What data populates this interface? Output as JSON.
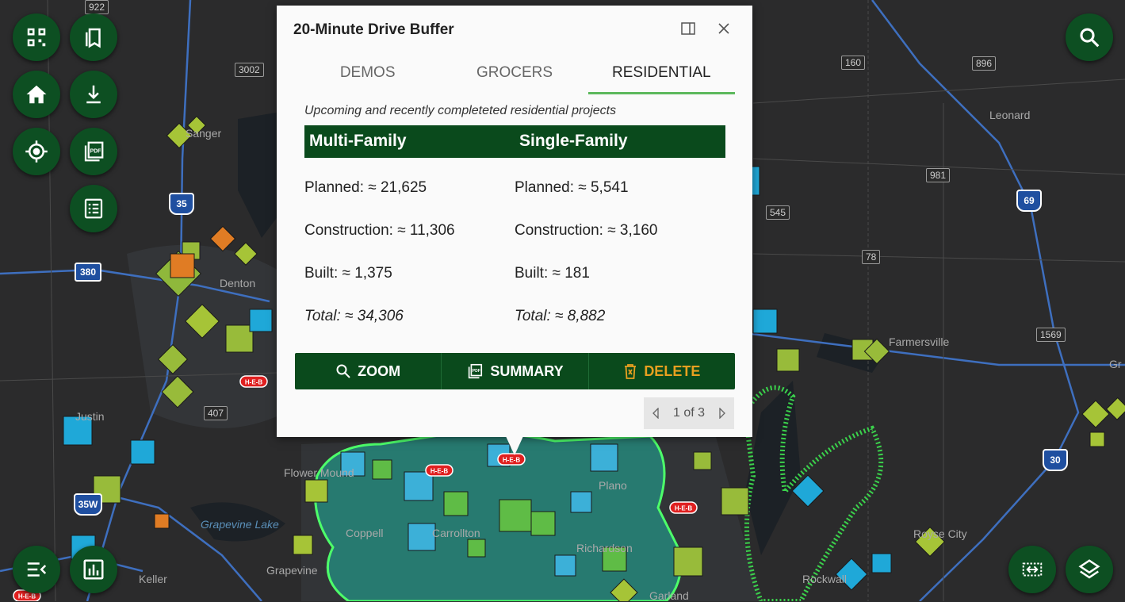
{
  "popup": {
    "title": "20-Minute Drive Buffer",
    "tabs": [
      {
        "label": "DEMOS"
      },
      {
        "label": "GROCERS"
      },
      {
        "label": "RESIDENTIAL"
      }
    ],
    "subtitle": "Upcoming and recently completeted residential projects",
    "columns": [
      "Multi-Family",
      "Single-Family"
    ],
    "rows": [
      {
        "left": "Planned: ≈ 21,625",
        "right": "Planned: ≈ 5,541"
      },
      {
        "left": "Construction: ≈ 11,306",
        "right": "Construction: ≈ 3,160"
      },
      {
        "left": "Built: ≈ 1,375",
        "right": "Built: ≈ 181"
      },
      {
        "left": "Total: ≈ 34,306",
        "right": "Total: ≈ 8,882"
      }
    ],
    "actions": {
      "zoom": "ZOOM",
      "summary": "SUMMARY",
      "delete": "DELETE"
    },
    "pager": "1 of 3"
  },
  "map": {
    "places": {
      "sanger": "Sanger",
      "leonard": "Leonard",
      "farmersville": "Farmersville",
      "flower_mound": "Flower Mound",
      "grapevine_lake": "Grapevine Lake",
      "grapevine": "Grapevine",
      "keller": "Keller",
      "coppell": "Coppell",
      "carrollton": "Carrollton",
      "richardson": "Richardson",
      "garland": "Garland",
      "plano": "Plano",
      "denton": "Denton",
      "justin": "Justin",
      "royse_city": "Royse City",
      "rockwall": "Rockwall",
      "greenville": "Gr"
    },
    "shields": {
      "s922": "922",
      "s3002": "3002",
      "s160": "160",
      "s896": "896",
      "s981": "981",
      "s545": "545",
      "s78": "78",
      "s1569": "1569",
      "s407": "407",
      "i35": "35",
      "u380": "380",
      "u69": "69",
      "i30": "30",
      "i35w": "35W"
    },
    "heb_label": "H-E-B"
  },
  "colors": {
    "brand_green": "#0a4a1c",
    "active_tab": "#5cb85c",
    "delete_orange": "#e8a020",
    "map_bg": "#2a2a2b"
  }
}
